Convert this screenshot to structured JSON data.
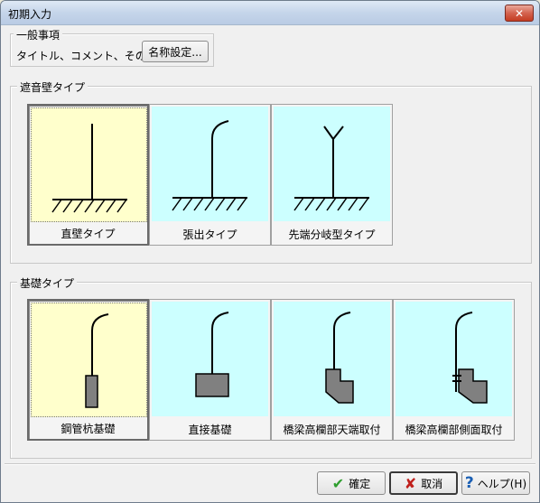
{
  "window": {
    "title": "初期入力",
    "close_label": "✕"
  },
  "general": {
    "group_label": "一般事項",
    "row_label": "タイトル、コメント、その他:",
    "name_button": "名称設定..."
  },
  "wall_type": {
    "group_label": "遮音壁タイプ",
    "tiles": [
      {
        "label": "直壁タイプ",
        "selected": true,
        "bg": "#ffffcc"
      },
      {
        "label": "張出タイプ",
        "selected": false,
        "bg": "#ccffff"
      },
      {
        "label": "先端分岐型タイプ",
        "selected": false,
        "bg": "#ccffff"
      }
    ]
  },
  "foundation_type": {
    "group_label": "基礎タイプ",
    "tiles": [
      {
        "label": "鋼管杭基礎",
        "selected": true,
        "bg": "#ffffcc"
      },
      {
        "label": "直接基礎",
        "selected": false,
        "bg": "#ccffff"
      },
      {
        "label": "橋梁高欄部天端取付",
        "selected": false,
        "bg": "#ccffff"
      },
      {
        "label": "橋梁高欄部側面取付",
        "selected": false,
        "bg": "#ccffff"
      }
    ]
  },
  "footer": {
    "ok_label": "確定",
    "cancel_label": "取消",
    "help_label": "ヘルプ(H)"
  },
  "colors": {
    "ok_check": "#2e9e2e",
    "cancel_x": "#c0201c",
    "help_q": "#1a5fb4",
    "fill_gray": "#808080"
  }
}
